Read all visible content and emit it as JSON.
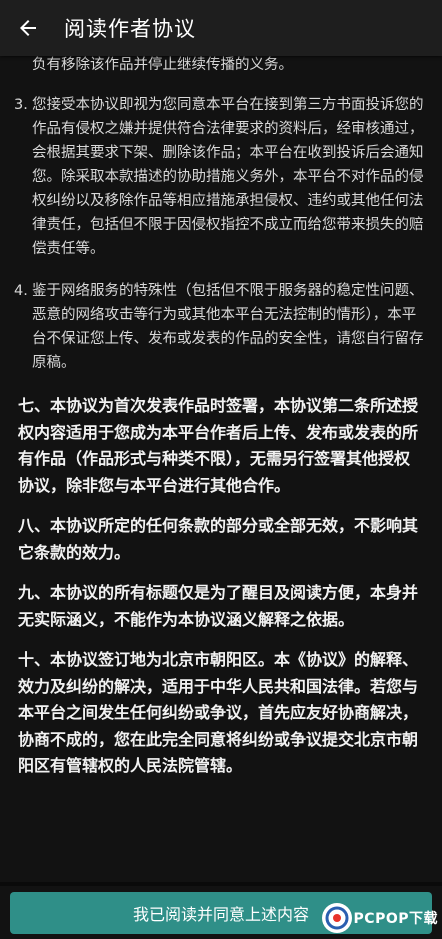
{
  "header": {
    "title": "阅读作者协议"
  },
  "content": {
    "partial_top": "人乐控。住本平台保证在接到真实作者投诉并经审核通过后，负有移除该作品并停止继续传播的义务。",
    "items": [
      {
        "num": "3.",
        "text": "您接受本协议即视为您同意本平台在接到第三方书面投诉您的作品有侵权之嫌并提供符合法律要求的资料后，经审核通过，会根据其要求下架、删除该作品；本平台在收到投诉后会通知您。除采取本款描述的协助措施义务外，本平台不对作品的侵权纠纷以及移除作品等相应措施承担侵权、违约或其他任何法律责任，包括但不限于因侵权指控不成立而给您带来损失的赔偿责任等。"
      },
      {
        "num": "4.",
        "text": "鉴于网络服务的特殊性（包括但不限于服务器的稳定性问题、恶意的网络攻击等行为或其他本平台无法控制的情形），本平台不保证您上传、发布或发表的作品的安全性，请您自行留存原稿。"
      }
    ],
    "sections": [
      "七、本协议为首次发表作品时签署，本协议第二条所述授权内容适用于您成为本平台作者后上传、发布或发表的所有作品（作品形式与种类不限），无需另行签署其他授权协议，除非您与本平台进行其他合作。",
      "八、本协议所定的任何条款的部分或全部无效，不影响其它条款的效力。",
      "九、本协议的所有标题仅是为了醒目及阅读方便，本身并无实际涵义，不能作为本协议涵义解释之依据。",
      "十、本协议签订地为北京市朝阳区。本《协议》的解释、效力及纠纷的解决，适用于中华人民共和国法律。若您与本平台之间发生任何纠纷或争议，首先应友好协商解决，协商不成的，您在此完全同意将纠纷或争议提交北京市朝阳区有管辖权的人民法院管辖。"
    ]
  },
  "footer": {
    "agree_label": "我已阅读并同意上述内容"
  },
  "watermark": {
    "text": "PCPOP下载"
  },
  "colors": {
    "background": "#121212",
    "topbar": "#1e1e1e",
    "button": "#2f8f88"
  },
  "icons": {
    "back": "arrow-left-icon",
    "watermark": "pcpop-logo-icon"
  }
}
